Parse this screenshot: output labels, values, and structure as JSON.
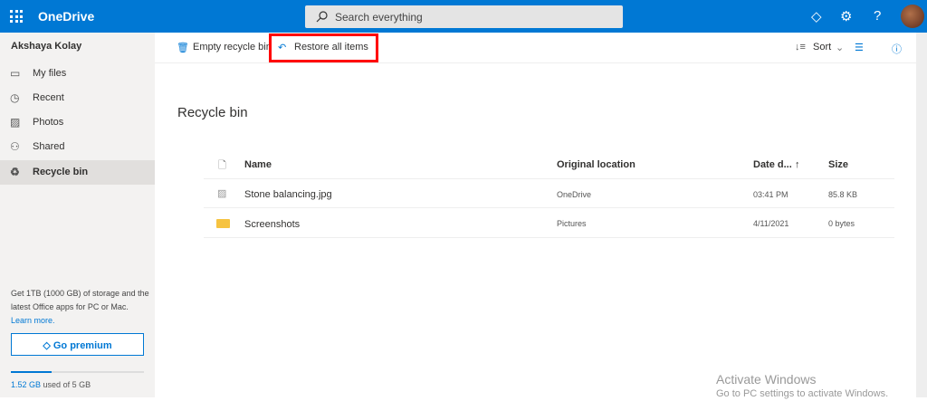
{
  "header": {
    "app_name": "OneDrive",
    "search_placeholder": "Search everything"
  },
  "sidebar": {
    "user": "Akshaya Kolay",
    "items": [
      {
        "label": "My files"
      },
      {
        "label": "Recent"
      },
      {
        "label": "Photos"
      },
      {
        "label": "Shared"
      },
      {
        "label": "Recycle bin"
      }
    ],
    "promo": "Get 1TB (1000 GB) of storage and the latest Office apps for PC or Mac.",
    "learn_more": "Learn more.",
    "premium_label": "Go premium",
    "storage_used": "1.52 GB",
    "storage_suffix": "used of 5 GB",
    "storage_fraction": 0.304
  },
  "commands": {
    "empty": "Empty recycle bin",
    "restore": "Restore all items",
    "sort": "Sort"
  },
  "page_title": "Recycle bin",
  "table": {
    "headers": {
      "name": "Name",
      "location": "Original location",
      "date": "Date d...",
      "size": "Size"
    },
    "rows": [
      {
        "name": "Stone balancing.jpg",
        "location": "OneDrive",
        "date": "03:41 PM",
        "size": "85.8 KB"
      },
      {
        "name": "Screenshots",
        "location": "Pictures",
        "date": "4/11/2021",
        "size": "0 bytes"
      }
    ]
  },
  "watermark": {
    "title": "Activate Windows",
    "subtitle": "Go to PC settings to activate Windows."
  }
}
